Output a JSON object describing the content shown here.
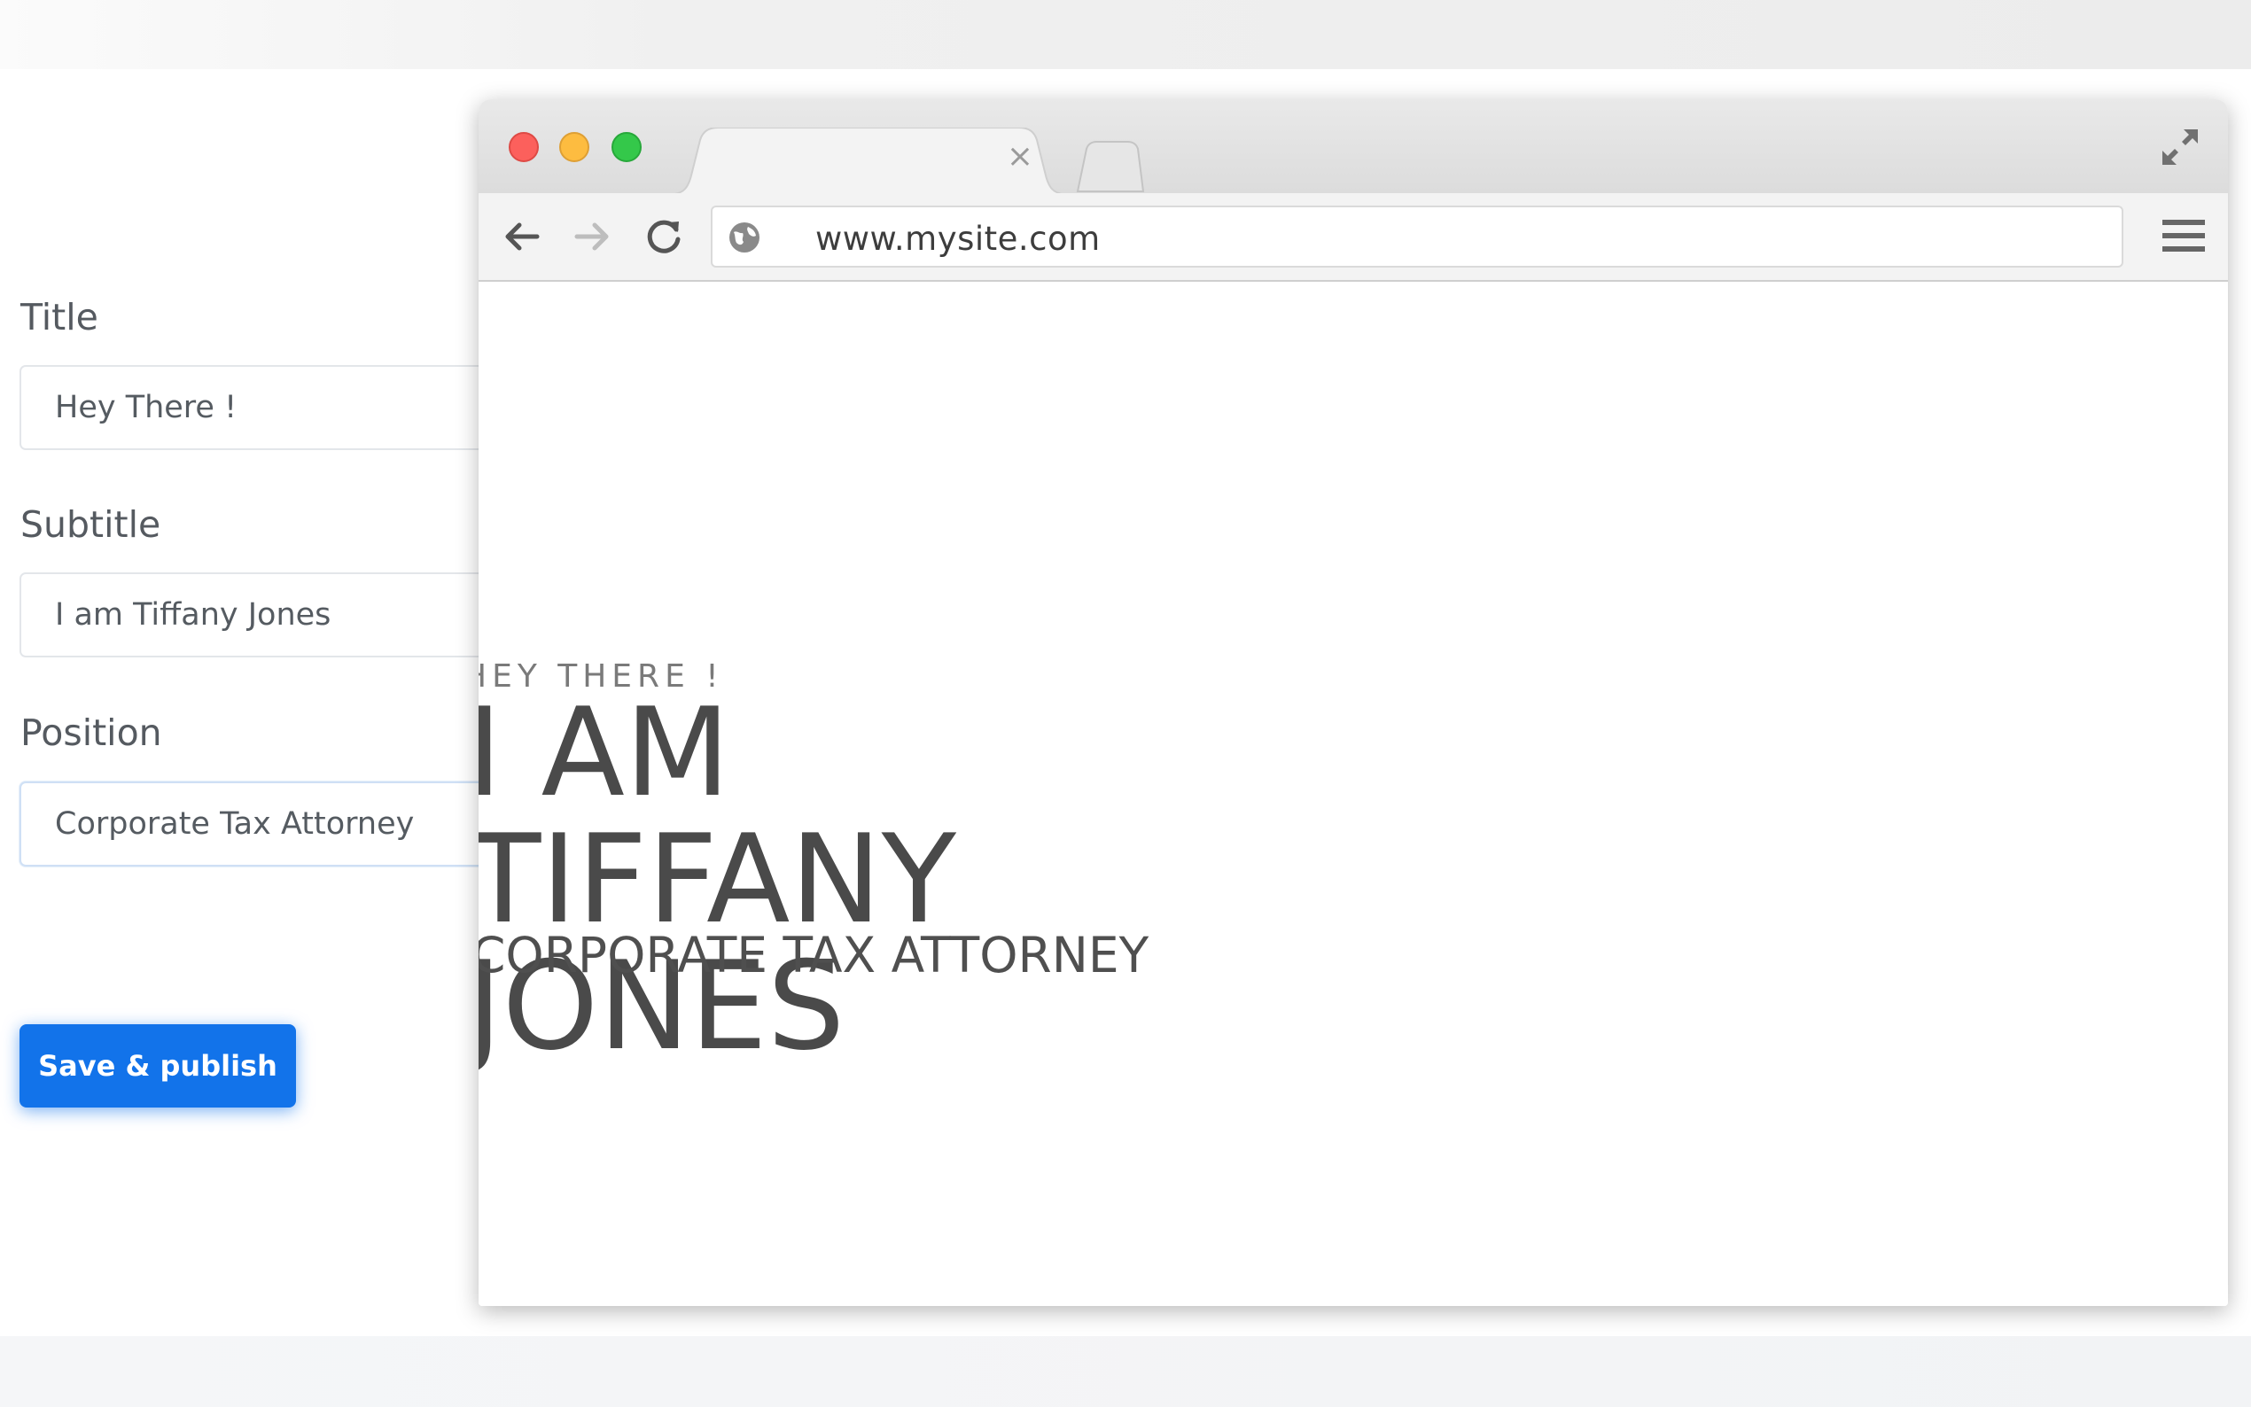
{
  "editor": {
    "fields": [
      {
        "label": "Title",
        "value": "Hey There !"
      },
      {
        "label": "Subtitle",
        "value": "I am Tiffany Jones"
      },
      {
        "label": "Position",
        "value": "Corporate Tax Attorney"
      }
    ],
    "save_label": "Save & publish",
    "accent_color": "#1273ea"
  },
  "browser": {
    "tab_close": "×",
    "url": "www.mysite.com",
    "icons": [
      "back-icon",
      "forward-icon",
      "reload-icon",
      "globe-icon",
      "menu-icon",
      "fullscreen-icon"
    ]
  },
  "preview": {
    "kicker": "HEY THERE !",
    "title": "I AM TIFFANY\nJONES",
    "position": "CORPORATE TAX ATTORNEY"
  }
}
